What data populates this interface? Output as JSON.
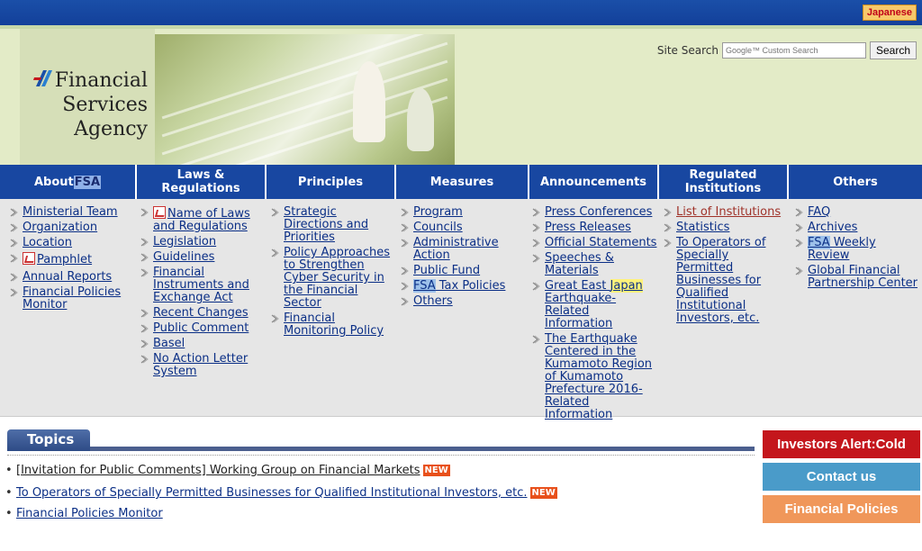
{
  "topbar": {
    "language_button": "Japanese"
  },
  "header": {
    "logo_lines": [
      "Financial",
      "Services",
      "Agency"
    ],
    "search_label": "Site Search",
    "search_placeholder": "Google™ Custom Search",
    "search_button": "Search"
  },
  "nav": {
    "tabs": [
      {
        "pre": "About ",
        "hl": "FSA",
        "post": ""
      },
      {
        "pre": "Laws & Regulations",
        "hl": "",
        "post": ""
      },
      {
        "pre": "Principles",
        "hl": "",
        "post": ""
      },
      {
        "pre": "Measures",
        "hl": "",
        "post": ""
      },
      {
        "pre": "Announcements",
        "hl": "",
        "post": ""
      },
      {
        "pre": "Regulated Institutions",
        "hl": "",
        "post": ""
      },
      {
        "pre": "Others",
        "hl": "",
        "post": ""
      }
    ]
  },
  "menu": {
    "about": [
      "Ministerial Team",
      "Organization",
      "Location",
      "Pamphlet",
      "Annual Reports",
      "Financial Policies Monitor"
    ],
    "laws": [
      "Name of Laws and Regulations",
      "Legislation",
      "Guidelines",
      "Financial Instruments and Exchange Act",
      "Recent Changes",
      "Public Comment",
      "Basel",
      "No Action Letter System"
    ],
    "principles": [
      "Strategic Directions and Priorities",
      "Policy Approaches to Strengthen Cyber Security in the Financial Sector",
      "Financial Monitoring Policy"
    ],
    "measures": {
      "program": "Program",
      "councils": "Councils",
      "admin": "Administrative Action",
      "public_fund": "Public Fund",
      "tax_hl": "FSA",
      "tax_rest": " Tax Policies",
      "others": "Others"
    },
    "announcements": {
      "press_conf": "Press Conferences",
      "press_rel": "Press Releases",
      "statements": "Official Statements",
      "speeches": "Speeches & Materials",
      "quake_pre": "Great East ",
      "quake_hl": "Japan",
      "quake_post": " Earthquake-Related Information",
      "kumamoto": "The Earthquake Centered in the Kumamoto Region of Kumamoto Prefecture 2016-Related Information"
    },
    "regulated": [
      "List of Institutions",
      "Statistics",
      "To Operators of Specially Permitted Businesses for Qualified Institutional Investors, etc."
    ],
    "others": {
      "faq": "FAQ",
      "archives": "Archives",
      "weekly_hl": "FSA",
      "weekly_rest": " Weekly Review",
      "global": "Global Financial Partnership Center"
    }
  },
  "topics": {
    "label": "Topics",
    "items": [
      {
        "text": "[Invitation for Public Comments] Working Group on Financial Markets",
        "badge": "NEW"
      },
      {
        "text": "To Operators of Specially Permitted Businesses for Qualified Institutional Investors, etc.",
        "badge": "NEW"
      },
      {
        "text": "Financial Policies Monitor",
        "badge": ""
      }
    ]
  },
  "side_buttons": [
    {
      "label": "Investors Alert:Cold Calling",
      "color": "#c4161c"
    },
    {
      "label": "Contact us",
      "color": "#4a9bc9"
    },
    {
      "label": "Financial Policies Monitor",
      "color": "#f0975a"
    }
  ]
}
